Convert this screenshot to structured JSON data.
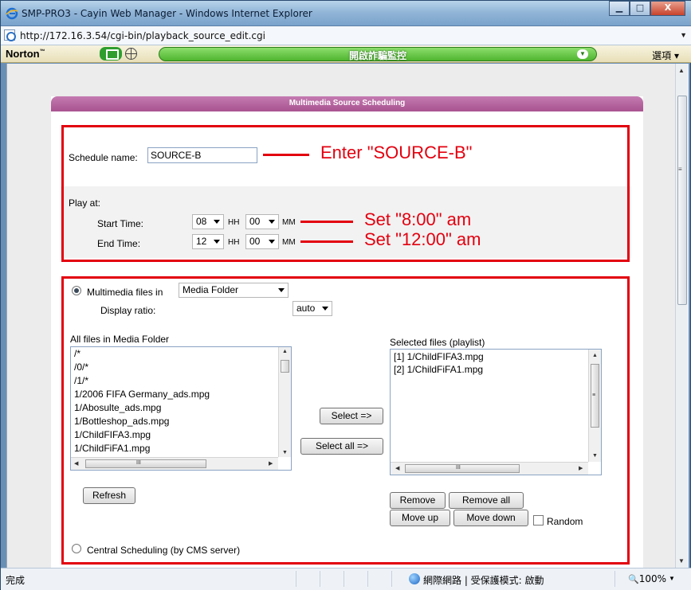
{
  "window": {
    "title": "SMP-PRO3 - Cayin Web Manager - Windows Internet Explorer",
    "minimize_glyph": "▁",
    "maximize_glyph": "□",
    "close_glyph": "X"
  },
  "address_bar": {
    "url": "http://172.16.3.54/cgi-bin/playback_source_edit.cgi",
    "dropdown_glyph": "▼"
  },
  "norton_toolbar": {
    "brand": "Norton",
    "trademark": "™",
    "safe_web_label": "開啟詐騙監控",
    "options_label": "選項 ▾",
    "brand_color": "#3cab2a"
  },
  "panel": {
    "title": "Multimedia Source Scheduling",
    "header_color": "#b15c97"
  },
  "schedule": {
    "name_label": "Schedule name:",
    "name_value": "SOURCE-B",
    "play_at_label": "Play at:",
    "start_time_label": "Start Time:",
    "start_hh": "08",
    "start_mm": "00",
    "end_time_label": "End Time:",
    "end_hh": "12",
    "end_mm": "00",
    "hh_unit": "HH",
    "mm_unit": "MM"
  },
  "annotations": {
    "enter_name": "Enter \"SOURCE-B\"",
    "set_start": "Set \"8:00\" am",
    "set_end": "Set \"12:00\" am",
    "color": "#e3000f"
  },
  "multimedia": {
    "radio_label": "Multimedia files in",
    "folder_select": "Media Folder",
    "display_ratio_label": "Display ratio:",
    "display_ratio_value": "auto",
    "all_files_label": "All files in Media Folder",
    "all_files": [
      "/*",
      "/0/*",
      "/1/*",
      "1/2006 FIFA Germany_ads.mpg",
      "1/Abosulte_ads.mpg",
      "1/Bottleshop_ads.mpg",
      "1/ChildFIFA3.mpg",
      "1/ChildFiFA1.mpg"
    ],
    "selected_label": "Selected files (playlist)",
    "selected_files": [
      "[1] 1/ChildFIFA3.mpg",
      "[2] 1/ChildFiFA1.mpg"
    ],
    "select_button": "Select =>",
    "select_all_button": "Select all =>",
    "refresh_button": "Refresh",
    "remove_button": "Remove",
    "remove_all_button": "Remove all",
    "move_up_button": "Move up",
    "move_down_button": "Move down",
    "random_label": "Random"
  },
  "central": {
    "radio_label": "Central Scheduling (by CMS server)"
  },
  "status_bar": {
    "status_text": "完成",
    "zone_text": "網際網路 | 受保護模式: 啟動",
    "zoom_text": "100%",
    "zoom_glyph": "🔍"
  },
  "scroll_glyphs": {
    "up": "▲",
    "down": "▼",
    "left": "◀",
    "right": "▶",
    "hgrip": "III",
    "vgrip": "≡"
  }
}
